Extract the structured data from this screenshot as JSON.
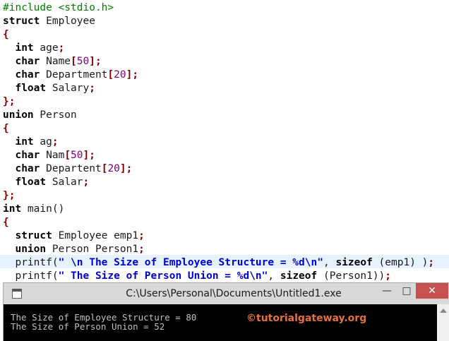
{
  "editor": {
    "lines": [
      "#include <stdio.h>",
      "struct Employee",
      "{",
      "  int age;",
      "  char Name[50];",
      "  char Department[20];",
      "  float Salary;",
      "};",
      "union Person",
      "{",
      "  int ag;",
      "  char Nam[50];",
      "  char Departent[20];",
      "  float Salar;",
      "};",
      "int main()",
      "{",
      "  struct Employee emp1;",
      "  union Person Person1;",
      "  printf(\" \\n The Size of Employee Structure = %d\\n\", sizeof (emp1) );",
      "  printf(\" The Size of Person Union = %d\\n\", sizeof (Person1));"
    ],
    "highlighted_line": 20
  },
  "console": {
    "title": "C:\\Users\\Personal\\Documents\\Untitled1.exe",
    "output": [
      "The Size of Employee Structure = 80",
      "The Size of Person Union = 52"
    ],
    "watermark": "©tutorialgateway.org",
    "min_glyph": "—",
    "max_glyph": "□",
    "close_glyph": "✕"
  }
}
